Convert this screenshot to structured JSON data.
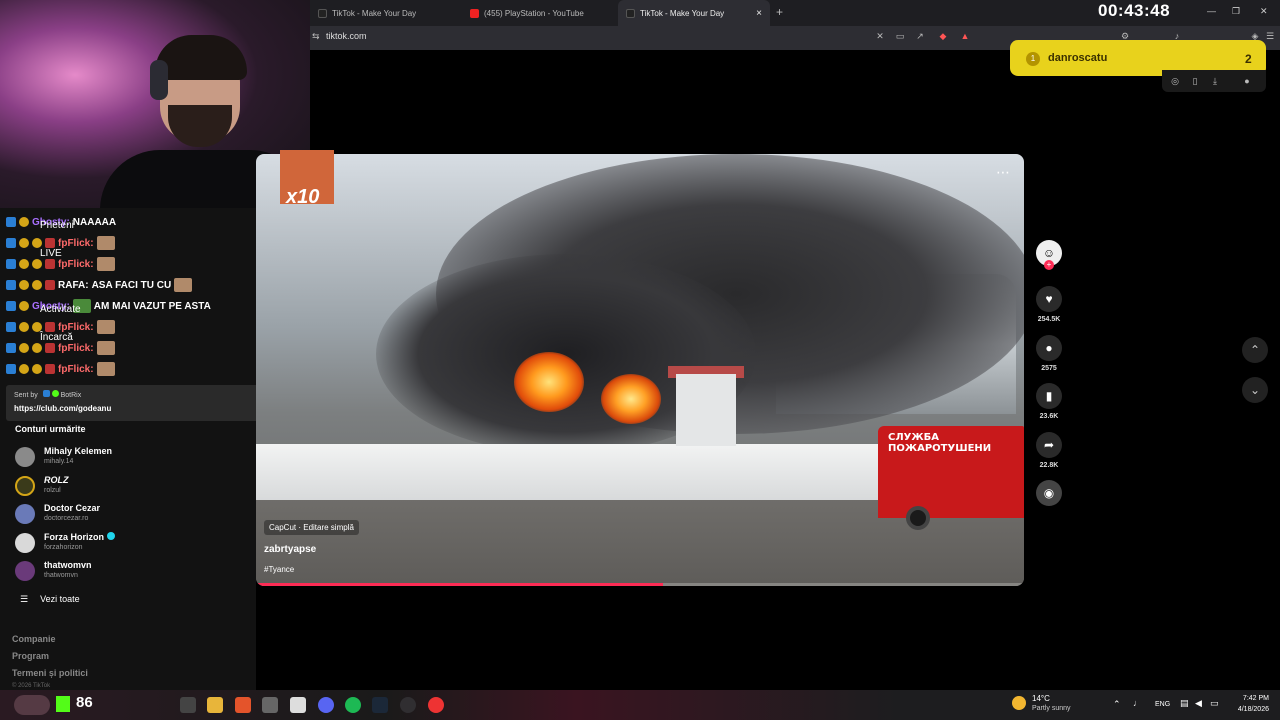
{
  "browser": {
    "tabs": [
      {
        "label": "TikTok - Make Your Day"
      },
      {
        "label": "(455) PlayStation - YouTube"
      },
      {
        "label": "TikTok - Make Your Day"
      }
    ],
    "url": "tiktok.com",
    "new_tab_label": "+",
    "close_label": "×"
  },
  "stream": {
    "timer": "00:43:48",
    "alert_user": "danroscatu",
    "alert_count": "2",
    "emote_multiplier": "x10"
  },
  "chat": [
    {
      "user": "Ghosty:",
      "text": "NAAAAA",
      "color": "#a970ff"
    },
    {
      "user": "fpFlick:",
      "text": "",
      "color": "#ff6b6b"
    },
    {
      "user": "fpFlick:",
      "text": "",
      "color": "#ff6b6b"
    },
    {
      "user": "RAFA:",
      "text": "ASA FACI TU CU",
      "color": "#ffffff"
    },
    {
      "user": "Ghosty:",
      "text": "AM MAI VAZUT PE ASTA",
      "color": "#a970ff"
    },
    {
      "user": "fpFlick:",
      "text": "",
      "color": "#ff6b6b"
    },
    {
      "user": "fpFlick:",
      "text": "",
      "color": "#ff6b6b"
    },
    {
      "user": "fpFlick:",
      "text": "",
      "color": "#ff6b6b"
    }
  ],
  "nav_overlay": {
    "prieteni": "Prieteni",
    "live": "LIVE",
    "activitate": "Activitate",
    "incarca": "Încarcă"
  },
  "botmsg": {
    "sent_by": "Sent by",
    "bot": "BotRix",
    "link": "https://club.com/godeanu"
  },
  "sidebar": {
    "following_title": "Conturi urmărite",
    "accounts": [
      {
        "name": "Mihaly Kelemen",
        "handle": "mihaly.14",
        "color": "#8a8a8a"
      },
      {
        "name": "ROLZ",
        "handle": "rolzul",
        "color": "#3a3a1a"
      },
      {
        "name": "Doctor Cezar",
        "handle": "doctorcezar.ro",
        "color": "#6a7ab8"
      },
      {
        "name": "Forza Horizon",
        "handle": "forzahorizon",
        "color": "#d9d9d9"
      },
      {
        "name": "thatwomvn",
        "handle": "thatwomvn",
        "color": "#6a3a7a"
      }
    ],
    "see_all": "Vezi toate",
    "footer": [
      "Companie",
      "Program",
      "Termeni și politici"
    ],
    "copyright": "© 2026 TikTok"
  },
  "video": {
    "capcut": "CapCut · Editare simplă",
    "author": "zabrtyapse",
    "tag": "#Tyance",
    "truck_text": "СЛУЖБА ПОЖАРОТУШЕНИ",
    "progress": 0.53
  },
  "actions": {
    "likes": "254.5K",
    "comments": "2575",
    "saves": "23.6K",
    "shares": "22.8K"
  },
  "taskbar": {
    "kick_count": "86",
    "temperature": "14°C",
    "condition": "Partly sunny",
    "language": "ENG",
    "time": "7:42 PM",
    "date": "4/18/2026"
  },
  "colors": {
    "alert": "#e8d21c",
    "tiktok_red": "#fe2c55"
  }
}
